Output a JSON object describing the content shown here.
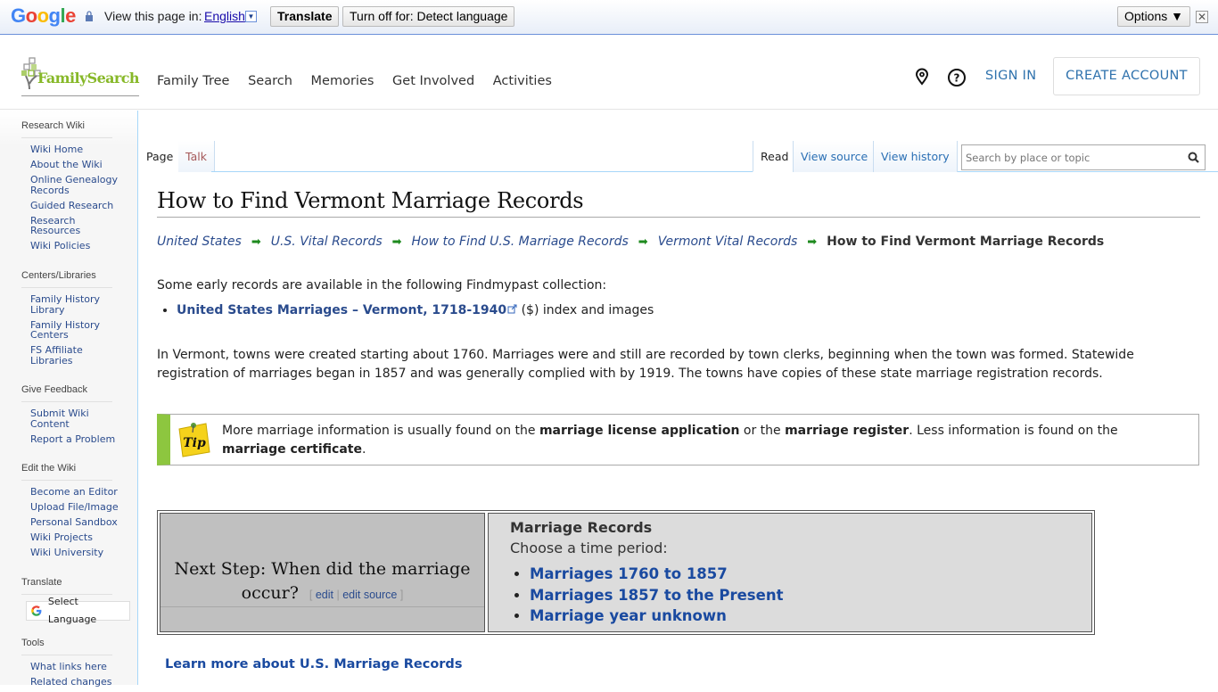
{
  "translate_bar": {
    "logo": [
      "G",
      "o",
      "o",
      "g",
      "l",
      "e"
    ],
    "view_in_label": "View this page in:",
    "language": "English",
    "translate_button": "Translate",
    "turn_off_button": "Turn off for: Detect language",
    "options_button": "Options ▼",
    "close": "✕"
  },
  "header": {
    "logo_text": "FamilySearch",
    "nav": [
      "Family Tree",
      "Search",
      "Memories",
      "Get Involved",
      "Activities"
    ],
    "sign_in": "SIGN IN",
    "create_account": "CREATE ACCOUNT"
  },
  "sidebar": {
    "sections": [
      {
        "title": "Research Wiki",
        "items": [
          "Wiki Home",
          "About the Wiki",
          "Online Genealogy Records",
          "Guided Research",
          "Research Resources",
          "Wiki Policies"
        ]
      },
      {
        "title": "Centers/Libraries",
        "items": [
          "Family History Library",
          "Family History Centers",
          "FS Affiliate Libraries"
        ]
      },
      {
        "title": "Give Feedback",
        "items": [
          "Submit Wiki Content",
          "Report a Problem"
        ]
      },
      {
        "title": "Edit the Wiki",
        "items": [
          "Become an Editor",
          "Upload File/Image",
          "Personal Sandbox",
          "Wiki Projects",
          "Wiki University"
        ]
      },
      {
        "title": "Translate",
        "select_language": "Select Language"
      },
      {
        "title": "Tools",
        "items": [
          "What links here",
          "Related changes"
        ]
      }
    ]
  },
  "tabs": {
    "left": [
      "Page",
      "Talk"
    ],
    "right": [
      "Read",
      "View source",
      "View history"
    ],
    "search_placeholder": "Search by place or topic"
  },
  "article": {
    "title": "How to Find Vermont Marriage Records",
    "breadcrumbs": [
      "United States",
      "U.S. Vital Records",
      "How to Find U.S. Marriage Records",
      "Vermont Vital Records"
    ],
    "breadcrumb_current": "How to Find Vermont Marriage Records",
    "intro": "Some early records are available in the following Findmypast collection:",
    "collection_link": "United States Marriages – Vermont, 1718-1940",
    "collection_suffix": " ($) index and images",
    "paragraph": "In Vermont, towns were created starting about 1760. Marriages were and still are recorded by town clerks, beginning when the town was formed. Statewide registration of marriages began in 1857 and was generally complied with by 1919. The towns have copies of these state marriage registration records.",
    "tip": {
      "icon_label": "Tip",
      "t1": "More marriage information is usually found on the ",
      "b1": "marriage license application",
      "t2": " or the ",
      "b2": "marriage register",
      "t3": ". Less information is found on the ",
      "b3": "marriage certificate",
      "t4": "."
    },
    "next_step": {
      "question": "Next Step: When did the marriage occur?",
      "edit": "edit",
      "edit_source": "edit source",
      "heading": "Marriage Records",
      "prompt": "Choose a time period:",
      "options": [
        "Marriages 1760 to 1857",
        "Marriages 1857 to the Present",
        "Marriage year unknown"
      ]
    },
    "learn_more": "Learn more about U.S. Marriage Records"
  }
}
